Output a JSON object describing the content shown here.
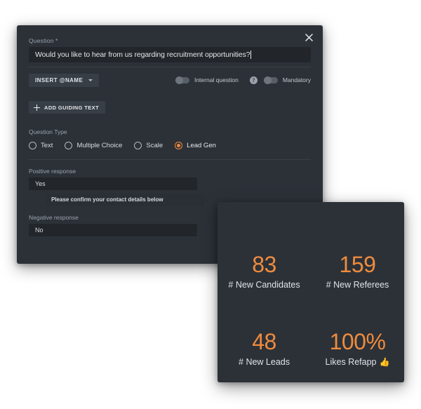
{
  "modal": {
    "close_icon": "close-icon",
    "question": {
      "label": "Question *",
      "value": "Would you like to hear from us regarding recruitment opportunities?"
    },
    "insert_name_button": "INSERT @NAME",
    "chevron_icon": "chevron-down-icon",
    "internal_question": {
      "label": "Internal question",
      "state": "off"
    },
    "help_icon_glyph": "?",
    "mandatory": {
      "label": "Mandatory",
      "state": "off"
    },
    "add_guiding_text_button": "ADD GUIDING TEXT",
    "question_type": {
      "label": "Question Type",
      "options": [
        {
          "label": "Text",
          "selected": false
        },
        {
          "label": "Multiple Choice",
          "selected": false
        },
        {
          "label": "Scale",
          "selected": false
        },
        {
          "label": "Lead Gen",
          "selected": true
        }
      ]
    },
    "positive_response": {
      "label": "Positive response",
      "value": "Yes"
    },
    "guiding_text": {
      "value": "Please confirm your contact details below"
    },
    "negative_response": {
      "label": "Negative response",
      "value": "No"
    }
  },
  "stats": {
    "accent_color": "#ef8b3d",
    "items": [
      {
        "value": "83",
        "label": "# New Candidates",
        "emoji": ""
      },
      {
        "value": "159",
        "label": "# New Referees",
        "emoji": ""
      },
      {
        "value": "48",
        "label": "# New Leads",
        "emoji": ""
      },
      {
        "value": "100%",
        "label": "Likes Refapp",
        "emoji": "👍"
      }
    ]
  }
}
